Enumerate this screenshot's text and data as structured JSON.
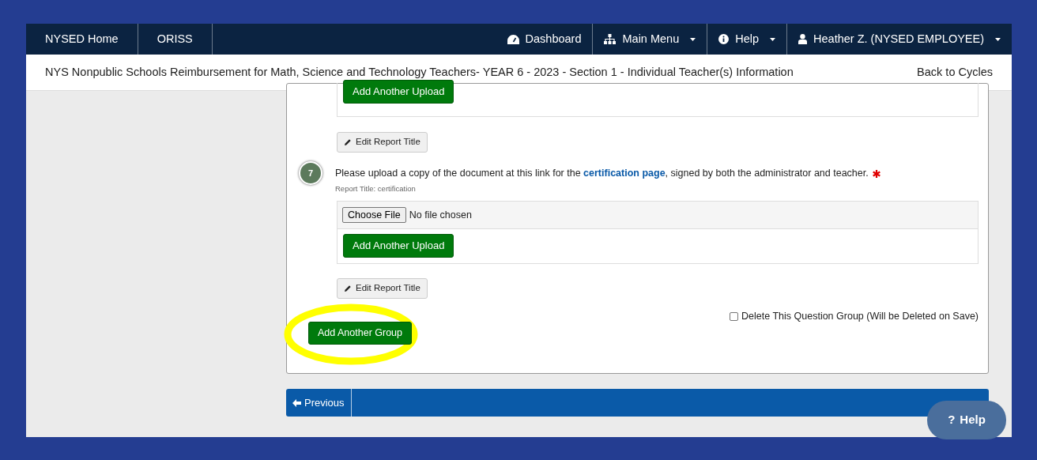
{
  "navbar": {
    "left_items": [
      {
        "label": "NYSED Home"
      },
      {
        "label": "ORISS"
      }
    ],
    "right_items": [
      {
        "kind": "dashboard",
        "label": "Dashboard",
        "dropdown": false
      },
      {
        "kind": "menu",
        "label": "Main Menu",
        "dropdown": true
      },
      {
        "kind": "help",
        "label": "Help",
        "dropdown": true
      },
      {
        "kind": "user",
        "label": "Heather Z. (NYSED EMPLOYEE)",
        "dropdown": true
      }
    ]
  },
  "subheader": {
    "title": "NYS Nonpublic Schools Reimbursement for Math, Science and Technology Teachers- YEAR 6 - 2023 - Section 1 - Individual Teacher(s) Information",
    "back_link": "Back to Cycles"
  },
  "previous_question": {
    "add_upload_button": "Add Another Upload",
    "edit_title_button": "Edit Report Title"
  },
  "question": {
    "number": "7",
    "text_before": "Please upload a copy of the document at this link for the",
    "link": "certification page",
    "text_after": ", signed by both the administrator and teacher.",
    "required": true,
    "report_title": "Report Title: certification",
    "choose_file_button": "Choose File",
    "file_status": "No file chosen",
    "add_upload_button": "Add Another Upload",
    "edit_title_button": "Edit Report Title"
  },
  "delete_group": {
    "label": "Delete This Question Group (Will be Deleted on Save)",
    "checked": false
  },
  "add_group_button": "Add Another Group",
  "pager": {
    "previous": "Previous"
  },
  "help_button": {
    "icon": "?",
    "label": "Help"
  }
}
